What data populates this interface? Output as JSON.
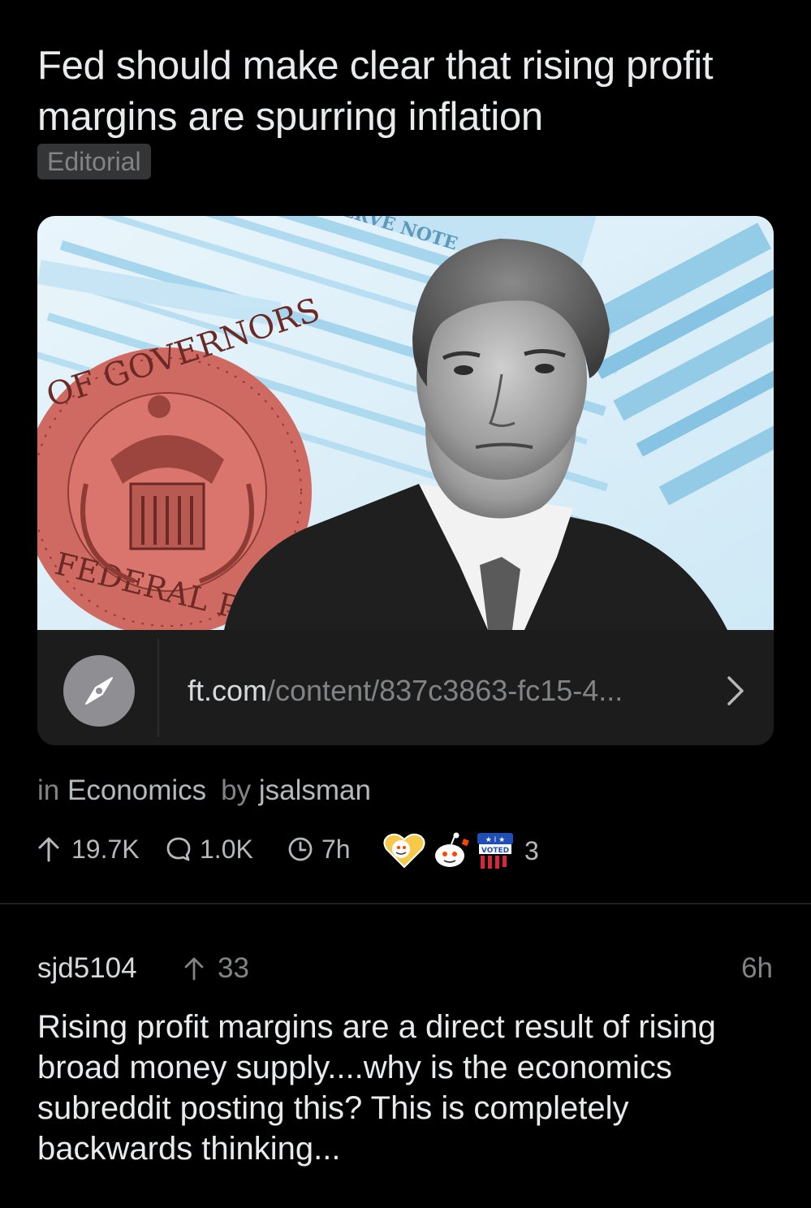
{
  "post": {
    "title": "Fed should make clear that rising profit margins are spurring inflation",
    "flair": "Editorial",
    "link": {
      "domain": "ft.com",
      "path": "/content/837c3863-fc15-4...",
      "icon": "compass-icon"
    },
    "meta": {
      "subreddit_prefix": "in",
      "subreddit": "Economics",
      "author_prefix": "by",
      "author": "jsalsman"
    },
    "stats": {
      "upvotes": "19.7K",
      "comments": "1.0K",
      "age": "7h",
      "awards_count": "3"
    }
  },
  "comment": {
    "author": "sjd5104",
    "score": "33",
    "time": "6h",
    "body": "Rising profit margins are a direct result of rising broad money supply....why is the economics subreddit posting this? This is completely backwards thinking..."
  },
  "colors": {
    "background": "#000000",
    "card": "#1c1c1d",
    "muted_text": "#818384",
    "primary_text": "#e8eaec",
    "seal_red": "#d9736b",
    "banknote_blue": "#8fcbe8"
  }
}
